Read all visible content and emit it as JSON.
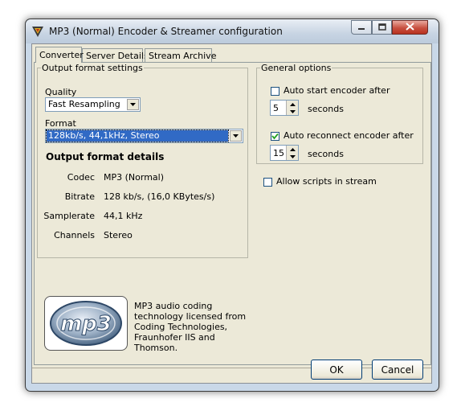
{
  "window": {
    "title": "MP3 (Normal) Encoder & Streamer configuration"
  },
  "tabs": [
    {
      "label": "Converter",
      "active": true
    },
    {
      "label": "Server Details",
      "active": false
    },
    {
      "label": "Stream Archive",
      "active": false
    }
  ],
  "output_format": {
    "legend": "Output format settings",
    "quality_label": "Quality",
    "quality_value": "Fast Resampling",
    "format_label": "Format",
    "format_value": "128kb/s, 44,1kHz, Stereo",
    "details_heading": "Output format details",
    "details": [
      {
        "key": "Codec",
        "value": "MP3 (Normal)"
      },
      {
        "key": "Bitrate",
        "value": "128 kb/s, (16,0 KBytes/s)"
      },
      {
        "key": "Samplerate",
        "value": "44,1 kHz"
      },
      {
        "key": "Channels",
        "value": "Stereo"
      }
    ]
  },
  "general_options": {
    "legend": "General options",
    "auto_start": {
      "label": "Auto start encoder after",
      "checked": false,
      "value": "5",
      "unit": "seconds"
    },
    "auto_reconnect": {
      "label": "Auto reconnect encoder after",
      "checked": true,
      "value": "15",
      "unit": "seconds"
    }
  },
  "allow_scripts": {
    "label": "Allow scripts in stream",
    "checked": false
  },
  "logo": {
    "text": "mp3"
  },
  "license_text": "MP3 audio coding technology licensed from Coding Technologies, Fraunhofer IIS and Thomson.",
  "buttons": {
    "ok": "OK",
    "cancel": "Cancel"
  },
  "colors": {
    "selection": "#316ac5",
    "close_button": "#c85040",
    "dialog_face": "#ece9d8"
  }
}
